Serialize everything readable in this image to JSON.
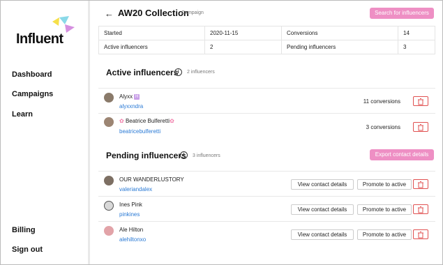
{
  "sidebar": {
    "logo": "Influent",
    "nav": [
      {
        "label": "Dashboard"
      },
      {
        "label": "Campaigns"
      },
      {
        "label": "Learn"
      }
    ],
    "bottom": [
      {
        "label": "Billing"
      },
      {
        "label": "Sign out"
      }
    ]
  },
  "header": {
    "back_icon": "arrow-left-icon",
    "title": "AW20 Collection",
    "tag": "Campaign",
    "search_button": "Search for influencers"
  },
  "stats": {
    "started_label": "Started",
    "started_value": "2020-11-15",
    "conversions_label": "Conversions",
    "conversions_value": "14",
    "active_label": "Active influencers",
    "active_value": "2",
    "pending_label": "Pending influencers",
    "pending_value": "3"
  },
  "active": {
    "heading": "Active influencers",
    "count": "2 influencers",
    "rows": [
      {
        "name": "Alyxx",
        "handle": "alyxxndra",
        "conversions": "11 conversions"
      },
      {
        "name": "Beatrice Bulferetti",
        "handle": "beatricebulferetti",
        "conversions": "3 conversions"
      }
    ]
  },
  "pending": {
    "heading": "Pending influencers",
    "count": "3 influencers",
    "export_button": "Export contact details",
    "view_label": "View contact details",
    "promote_label": "Promote to active",
    "rows": [
      {
        "name": "OUR WANDERLUSTORY",
        "handle": "valeriandalex"
      },
      {
        "name": "Ines Pink",
        "handle": "pinkines"
      },
      {
        "name": "Ale Hilton",
        "handle": "alehiltonxo"
      }
    ]
  },
  "colors": {
    "accent_pink": "#ee8fc4",
    "link_blue": "#2a7ad5",
    "danger_red": "#e05050"
  }
}
